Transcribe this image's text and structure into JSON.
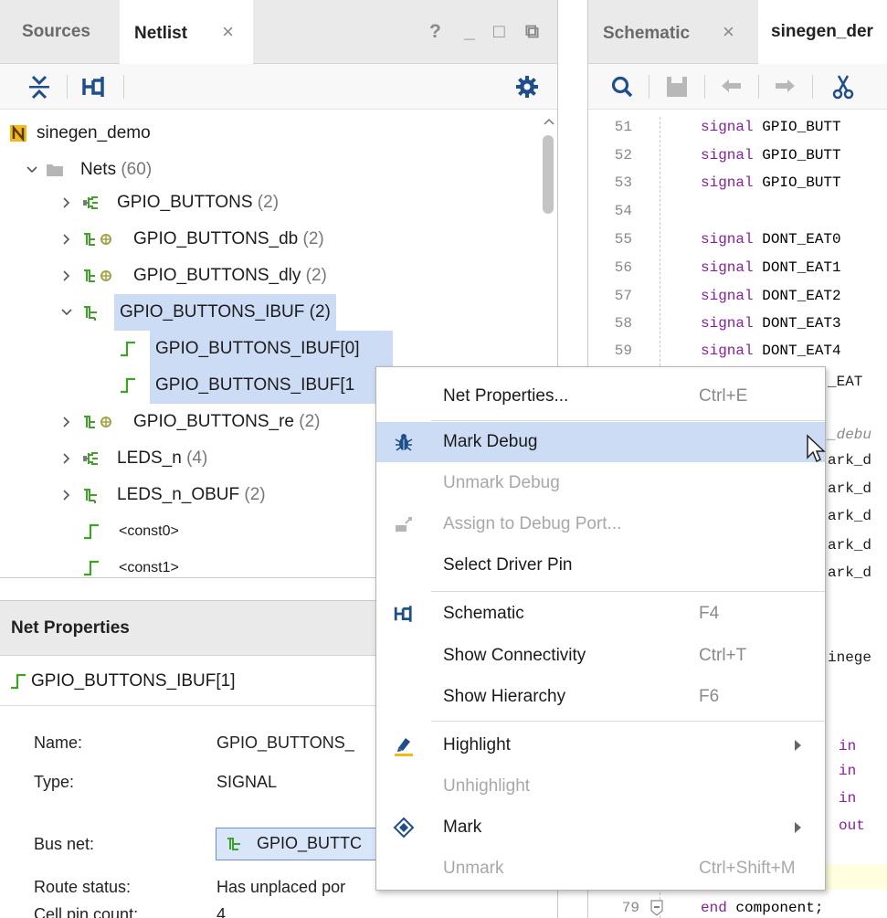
{
  "left_panel": {
    "tabs": [
      {
        "label": "Sources",
        "active": false
      },
      {
        "label": "Netlist",
        "active": true,
        "close": "×"
      }
    ],
    "window_controls": [
      "?",
      "_",
      "□",
      "⧉"
    ],
    "toolbar_icons": [
      "collapse-all-icon",
      "schematic-icon",
      "gear-icon"
    ],
    "tree": {
      "root": {
        "label": "sinegen_demo",
        "icon": "netlist-n-icon"
      },
      "nets_folder": {
        "label": "Nets",
        "count": "(60)"
      },
      "items": [
        {
          "label": "GPIO_BUTTONS",
          "count": "(2)",
          "icon": "bus-port-icon",
          "expanded": false
        },
        {
          "label": "GPIO_BUTTONS_db",
          "count": "(2)",
          "icon": "bus-debug-icon",
          "expanded": false
        },
        {
          "label": "GPIO_BUTTONS_dly",
          "count": "(2)",
          "icon": "bus-debug-icon",
          "expanded": false
        },
        {
          "label": "GPIO_BUTTONS_IBUF",
          "count": "(2)",
          "icon": "bus-icon",
          "expanded": true,
          "selected": true
        },
        {
          "label": "GPIO_BUTTONS_IBUF[0]",
          "icon": "net-icon",
          "selected": true,
          "child": true
        },
        {
          "label": "GPIO_BUTTONS_IBUF[1",
          "icon": "net-icon",
          "selected": true,
          "child": true
        },
        {
          "label": "GPIO_BUTTONS_re",
          "count": "(2)",
          "icon": "bus-debug-icon",
          "expanded": false
        },
        {
          "label": "LEDS_n",
          "count": "(4)",
          "icon": "bus-port-icon",
          "expanded": false
        },
        {
          "label": "LEDS_n_OBUF",
          "count": "(2)",
          "icon": "bus-icon",
          "expanded": false
        },
        {
          "label": "<const0>",
          "icon": "net-icon",
          "child": true
        },
        {
          "label": "<const1>",
          "icon": "net-icon",
          "child": true
        }
      ]
    }
  },
  "net_properties": {
    "title": "Net Properties",
    "net_name": "GPIO_BUTTONS_IBUF[1]",
    "fields": [
      {
        "label": "Name:",
        "value": "GPIO_BUTTONS_"
      },
      {
        "label": "Type:",
        "value": "SIGNAL"
      },
      {
        "label": "Bus net:",
        "value": "GPIO_BUTTC"
      },
      {
        "label": "Route status:",
        "value": "Has unplaced por"
      },
      {
        "label": "Cell pin count:",
        "value": "4"
      }
    ]
  },
  "right_panel": {
    "tabs": [
      {
        "label": "Schematic",
        "close": "×"
      },
      {
        "label": "sinegen_der",
        "active": true
      }
    ],
    "toolbar_icons": [
      "search-icon",
      "save-icon",
      "undo-icon",
      "redo-icon",
      "cut-icon"
    ],
    "code_lines": [
      {
        "num": "51",
        "kw": "signal",
        "text": " GPIO_BUTT"
      },
      {
        "num": "52",
        "kw": "signal",
        "text": " GPIO_BUTT"
      },
      {
        "num": "53",
        "kw": "signal",
        "text": " GPIO_BUTT"
      },
      {
        "num": "54",
        "kw": "",
        "text": ""
      },
      {
        "num": "55",
        "kw": "signal",
        "text": " DONT_EAT0"
      },
      {
        "num": "56",
        "kw": "signal",
        "text": " DONT_EAT1"
      },
      {
        "num": "57",
        "kw": "signal",
        "text": " DONT_EAT2"
      },
      {
        "num": "58",
        "kw": "signal",
        "text": " DONT_EAT3"
      },
      {
        "num": "59",
        "kw": "signal",
        "text": " DONT_EAT4"
      }
    ],
    "peek_lines": [
      "_EAT",
      "_debu",
      "ark_d",
      "ark_d",
      "ark_d",
      "ark_d",
      "ark_d",
      "inege",
      "in",
      "in",
      "in",
      "out"
    ],
    "last_line": {
      "num": "79",
      "kw": "end",
      "text": " component;"
    }
  },
  "context_menu": {
    "items": [
      {
        "label": "Net Properties...",
        "shortcut": "Ctrl+E",
        "enabled": true
      },
      {
        "label": "Mark Debug",
        "enabled": true,
        "highlighted": true,
        "icon": "bug-icon"
      },
      {
        "label": "Unmark Debug",
        "enabled": false
      },
      {
        "label": "Assign to Debug Port...",
        "enabled": false,
        "icon": "assign-debug-icon"
      },
      {
        "label": "Select Driver Pin",
        "enabled": true
      },
      {
        "label": "Schematic",
        "shortcut": "F4",
        "enabled": true,
        "icon": "schematic-icon"
      },
      {
        "label": "Show Connectivity",
        "shortcut": "Ctrl+T",
        "enabled": true
      },
      {
        "label": "Show Hierarchy",
        "shortcut": "F6",
        "enabled": true
      },
      {
        "label": "Highlight",
        "enabled": true,
        "submenu": true,
        "icon": "highlight-icon"
      },
      {
        "label": "Unhighlight",
        "enabled": false
      },
      {
        "label": "Mark",
        "enabled": true,
        "submenu": true,
        "icon": "mark-icon"
      },
      {
        "label": "Unmark",
        "shortcut": "Ctrl+Shift+M",
        "enabled": false
      }
    ]
  },
  "colors": {
    "selection": "#cddcf5",
    "net_green": "#3fa12a",
    "keyword_purple": "#8a1f9e",
    "header_gray": "#eaeaea"
  }
}
